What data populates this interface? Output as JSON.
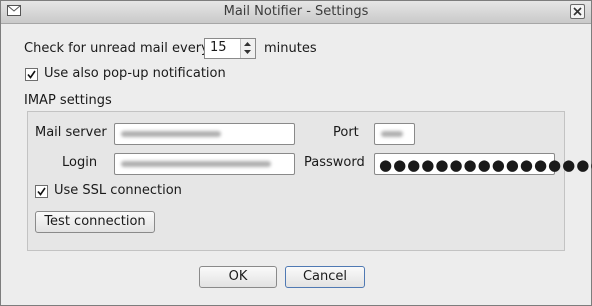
{
  "window": {
    "title": "Mail Notifier - Settings"
  },
  "check": {
    "prefix": "Check for unread mail every",
    "interval": "15",
    "suffix": "minutes"
  },
  "popup": {
    "label": "Use also pop-up notification",
    "checked": true
  },
  "imap": {
    "group_label": "IMAP settings",
    "server_label": "Mail server",
    "port_label": "Port",
    "login_label": "Login",
    "password_label": "Password",
    "password_mask": "●●●●●●●●●●●●●●●●",
    "ssl_label": "Use SSL connection",
    "ssl_checked": true,
    "test_button": "Test connection"
  },
  "buttons": {
    "ok": "OK",
    "cancel": "Cancel"
  },
  "icons": {
    "title": "mail-icon",
    "close": "close-icon",
    "spin_up": "arrow-up-icon",
    "spin_down": "arrow-down-icon",
    "check": "checkmark-icon"
  }
}
